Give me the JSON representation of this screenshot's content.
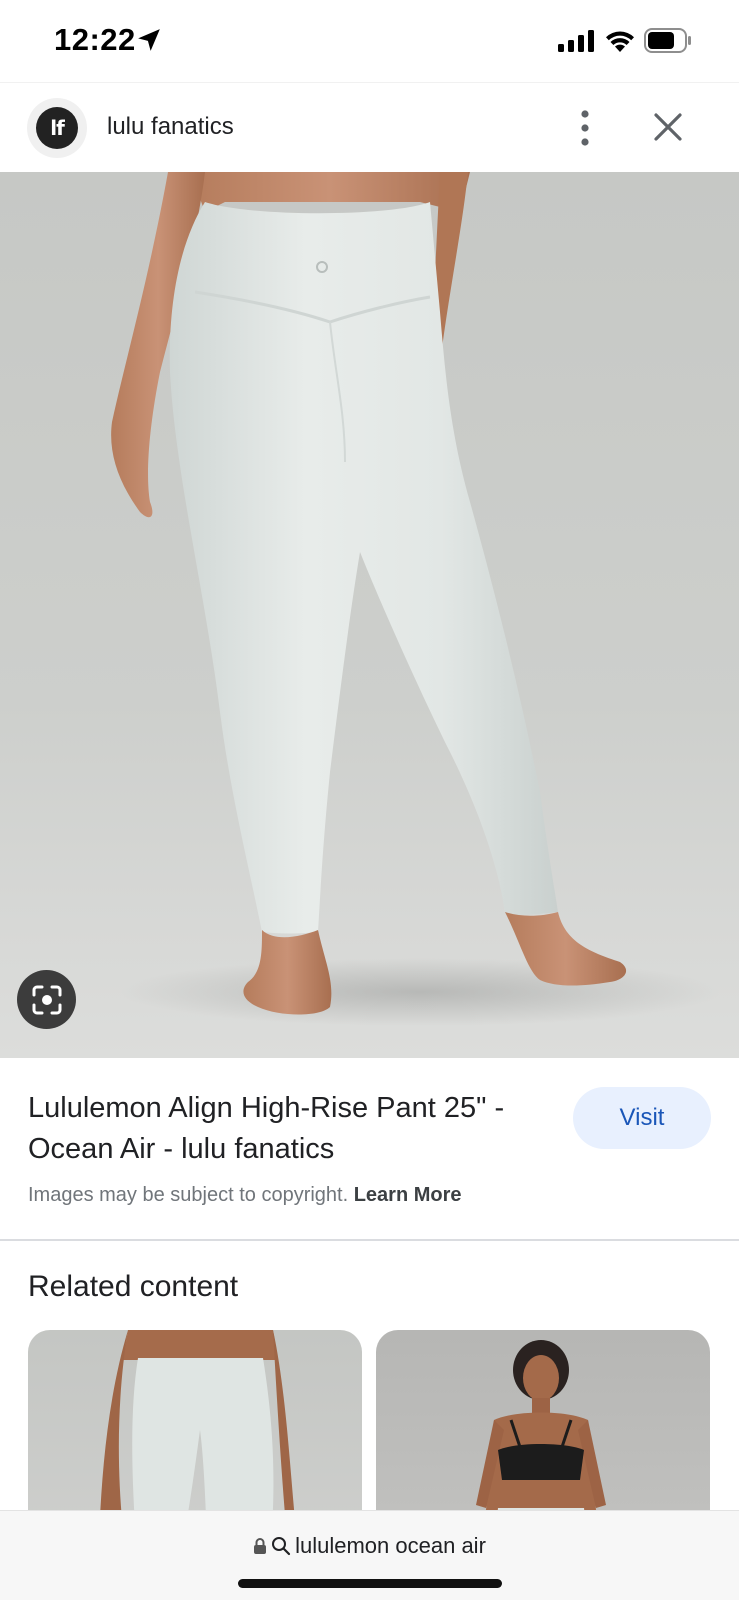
{
  "status_bar": {
    "time": "12:22"
  },
  "header": {
    "site_logo_text": "lf",
    "site_name": "lulu fanatics"
  },
  "product": {
    "title": "Lululemon Align High-Rise Pant 25\" - Ocean Air - lulu fanatics",
    "visit_label": "Visit",
    "copyright_text": "Images may be subject to copyright.",
    "learn_more_label": "Learn More"
  },
  "related": {
    "title": "Related content"
  },
  "bottom_bar": {
    "url_text": "lululemon ocean air"
  },
  "icons": {
    "location": "location-arrow-icon",
    "signal": "cellular-signal-icon",
    "wifi": "wifi-icon",
    "battery": "battery-icon",
    "more": "more-vertical-icon",
    "close": "close-icon",
    "lens": "lens-search-icon",
    "lock": "lock-icon",
    "search": "search-icon"
  },
  "colors": {
    "accent": "#1a56b8",
    "visit_bg": "#e8f0fe",
    "legging": "#e3e8e6"
  }
}
